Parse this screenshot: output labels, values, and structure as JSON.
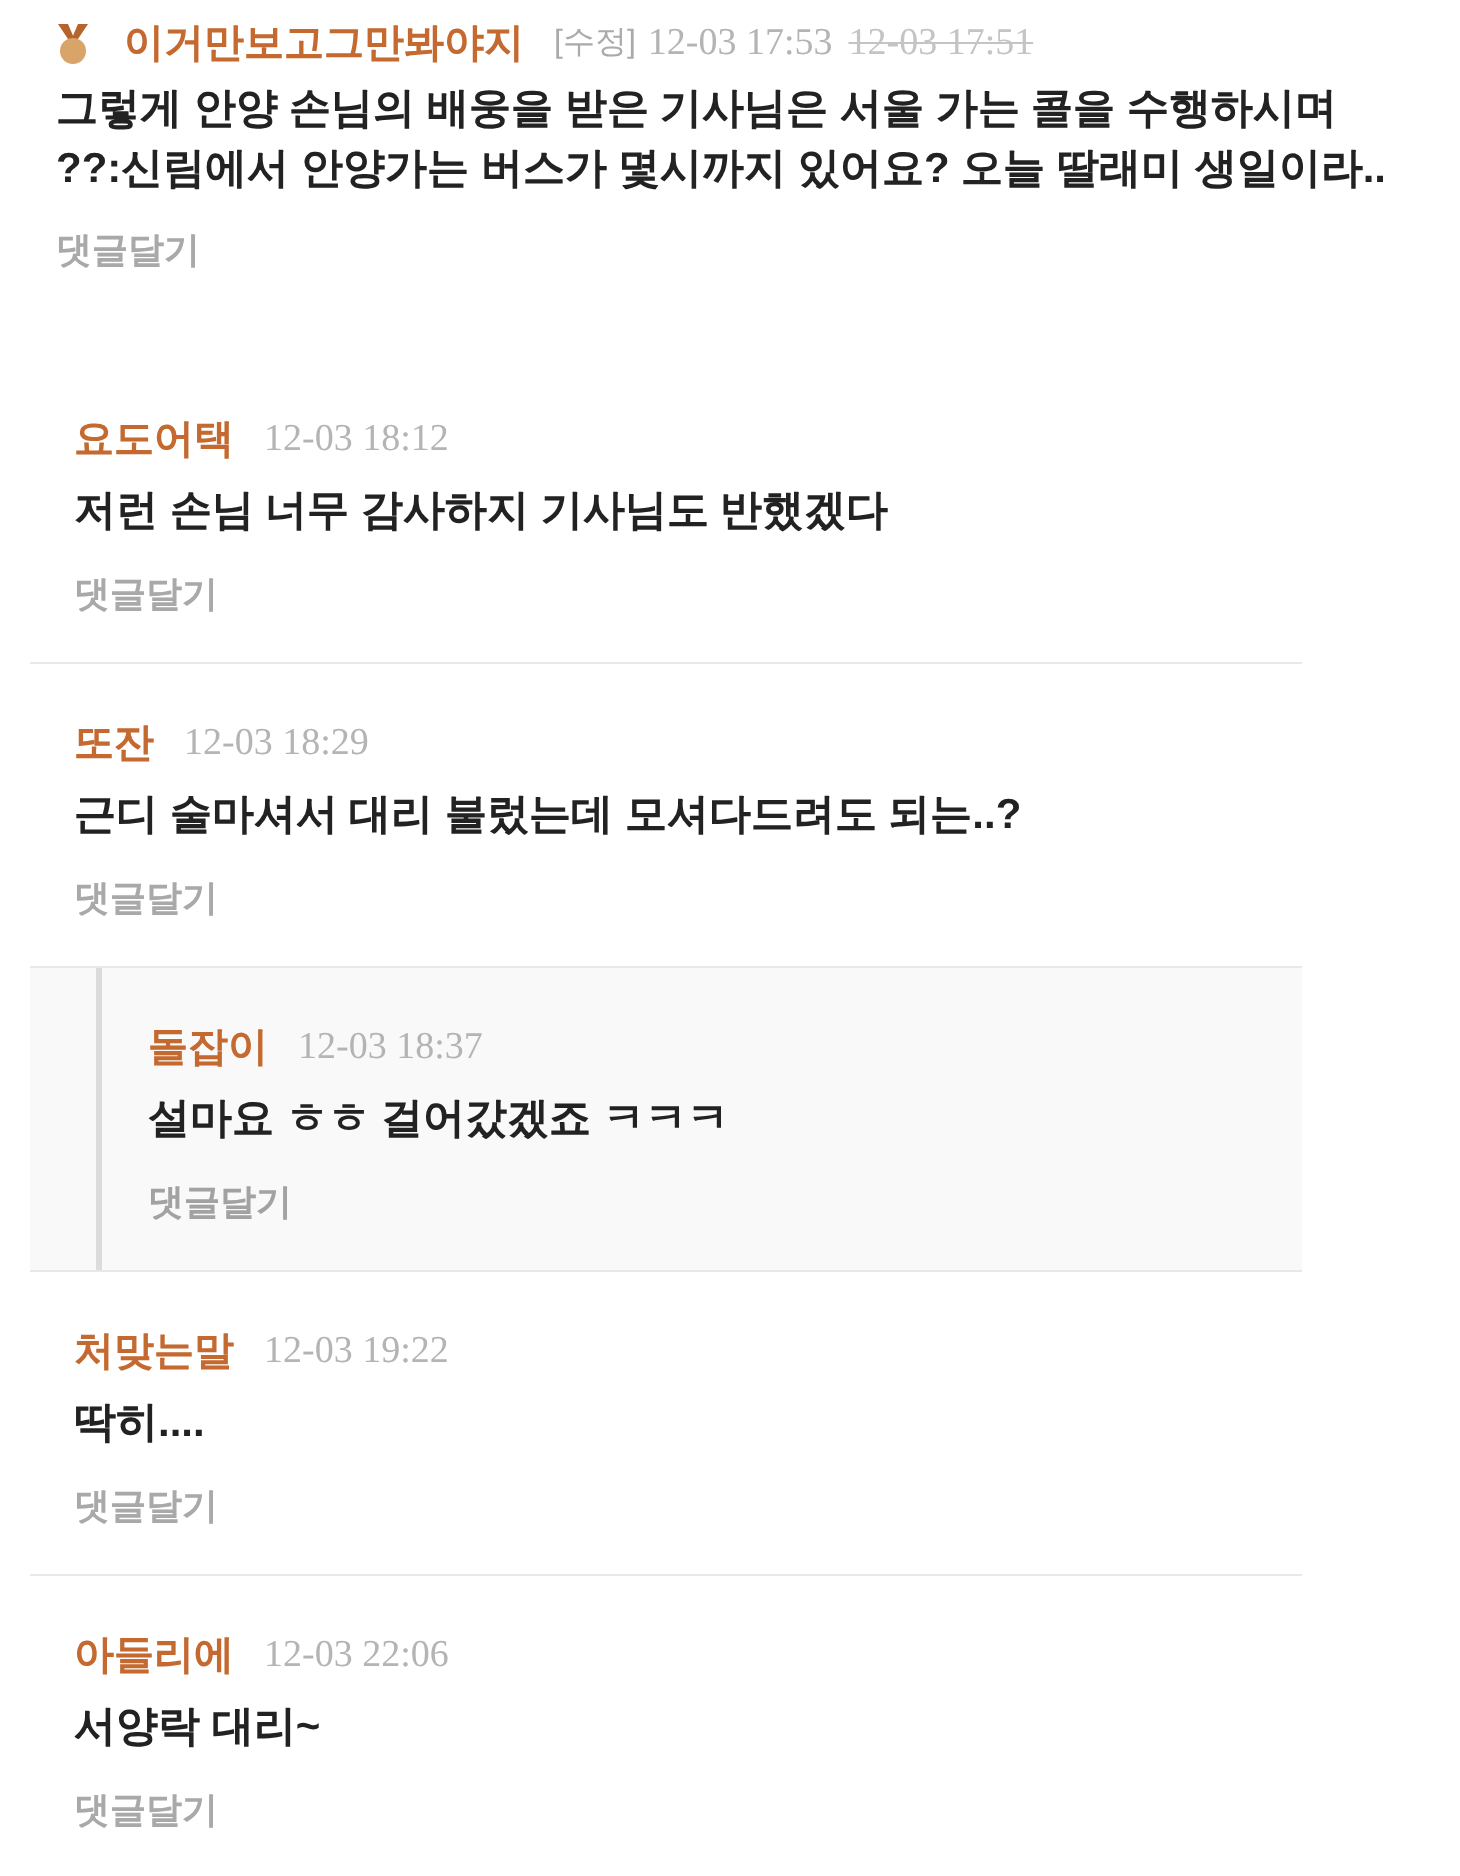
{
  "best_comment": {
    "author": "이거만보고그만봐야지",
    "edit_label": "[수정]",
    "time": "12-03 17:53",
    "previous_time": "12-03 17:51",
    "text": "그렇게 안양 손님의 배웅을 받은 기사님은 서울 가는 콜을 수행하시며\n??:신림에서 안양가는 버스가 몇시까지 있어요? 오늘 딸래미 생일이라..",
    "reply_link": "댓글달기"
  },
  "comments": [
    {
      "author": "요도어택",
      "time": "12-03 18:12",
      "text": "저런 손님 너무 감사하지 기사님도 반했겠다",
      "reply_link": "댓글달기"
    },
    {
      "author": "또잔",
      "time": "12-03 18:29",
      "text": "근디 술마셔서 대리 불렀는데 모셔다드려도 되는..?",
      "reply_link": "댓글달기",
      "children": [
        {
          "author": "돌잡이",
          "time": "12-03 18:37",
          "text": "설마요 ㅎㅎ 걸어갔겠죠 ㅋㅋㅋ",
          "reply_link": "댓글달기"
        }
      ]
    },
    {
      "author": "처맞는말",
      "time": "12-03 19:22",
      "text": "딱히....",
      "reply_link": "댓글달기"
    },
    {
      "author": "아들리에",
      "time": "12-03 22:06",
      "text": "서양락 대리~",
      "reply_link": "댓글달기"
    }
  ]
}
